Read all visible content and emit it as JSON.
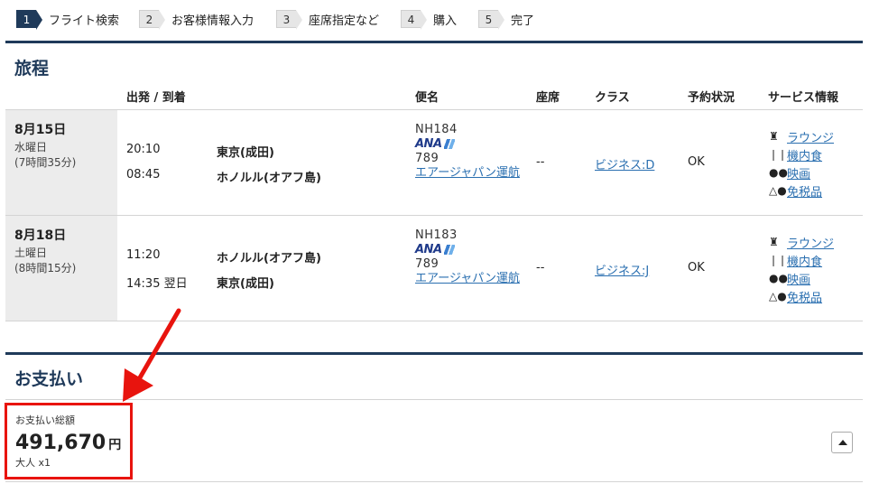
{
  "steps": [
    {
      "num": "1",
      "label": "フライト検索"
    },
    {
      "num": "2",
      "label": "お客様情報入力"
    },
    {
      "num": "3",
      "label": "座席指定など"
    },
    {
      "num": "4",
      "label": "購入"
    },
    {
      "num": "5",
      "label": "完了"
    }
  ],
  "itinerary": {
    "title": "旅程",
    "headers": {
      "route": "出発 / 到着",
      "flight": "便名",
      "seat": "座席",
      "class": "クラス",
      "status": "予約状況",
      "service": "サービス情報"
    },
    "flights": [
      {
        "date": "8月15日",
        "weekday": "水曜日",
        "duration": "(7時間35分)",
        "dep_time": "20:10",
        "dep_airport": "東京(成田)",
        "arr_time": "08:45",
        "arr_airport": "ホノルル(オアフ島)",
        "flight_no": "NH184",
        "airline_logo": "ANA",
        "aircraft": "789",
        "operator": "エアージャパン運航",
        "seat": "--",
        "class": "ビジネス:D",
        "status": "OK",
        "services": [
          "ラウンジ",
          "機内食",
          "映画",
          "免税品"
        ]
      },
      {
        "date": "8月18日",
        "weekday": "土曜日",
        "duration": "(8時間15分)",
        "dep_time": "11:20",
        "dep_airport": "ホノルル(オアフ島)",
        "arr_time": "14:35 翌日",
        "arr_airport": "東京(成田)",
        "flight_no": "NH183",
        "airline_logo": "ANA",
        "aircraft": "789",
        "operator": "エアージャパン運航",
        "seat": "--",
        "class": "ビジネス:J",
        "status": "OK",
        "services": [
          "ラウンジ",
          "機内食",
          "映画",
          "免税品"
        ]
      }
    ]
  },
  "payment": {
    "title": "お支払い",
    "caption": "お支払い総額",
    "amount": "491,670",
    "currency": "円",
    "pax": "大人 x1"
  },
  "icons": {
    "lounge": "lounge-icon",
    "meal": "meal-icon",
    "movie": "movie-icon",
    "dutyfree": "dutyfree-icon"
  },
  "colors": {
    "navy": "#1f3a5a",
    "link": "#2a6fb0",
    "highlight": "#e8140e"
  }
}
